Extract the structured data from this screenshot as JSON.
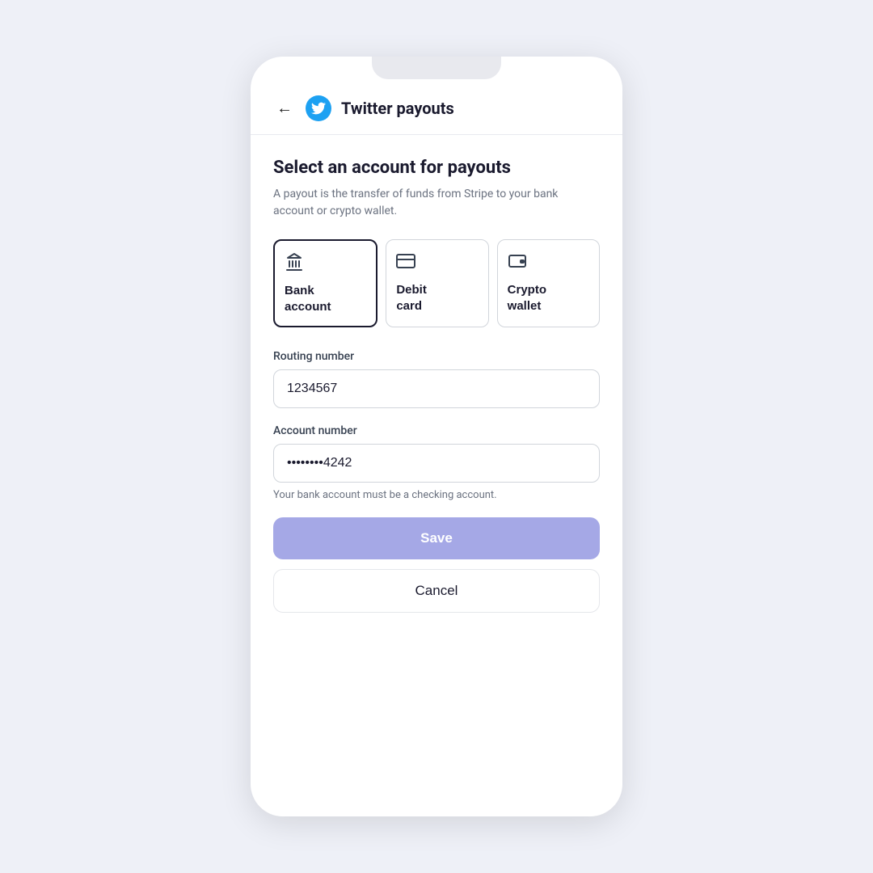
{
  "app": {
    "page_title": "Twitter payouts"
  },
  "header": {
    "title": "Twitter payouts",
    "back_label": "Back"
  },
  "main": {
    "section_title": "Select an account for payouts",
    "section_desc": "A payout is the transfer of funds from Stripe to your bank account or crypto wallet.",
    "account_options": [
      {
        "id": "bank",
        "label": "Bank account",
        "selected": true
      },
      {
        "id": "debit",
        "label": "Debit card",
        "selected": false
      },
      {
        "id": "crypto",
        "label": "Crypto wallet",
        "selected": false
      }
    ],
    "routing_label": "Routing number",
    "routing_value": "1234567",
    "account_label": "Account number",
    "account_value": "••••••••4242",
    "hint": "Your bank account must be a checking account.",
    "save_label": "Save",
    "cancel_label": "Cancel"
  }
}
